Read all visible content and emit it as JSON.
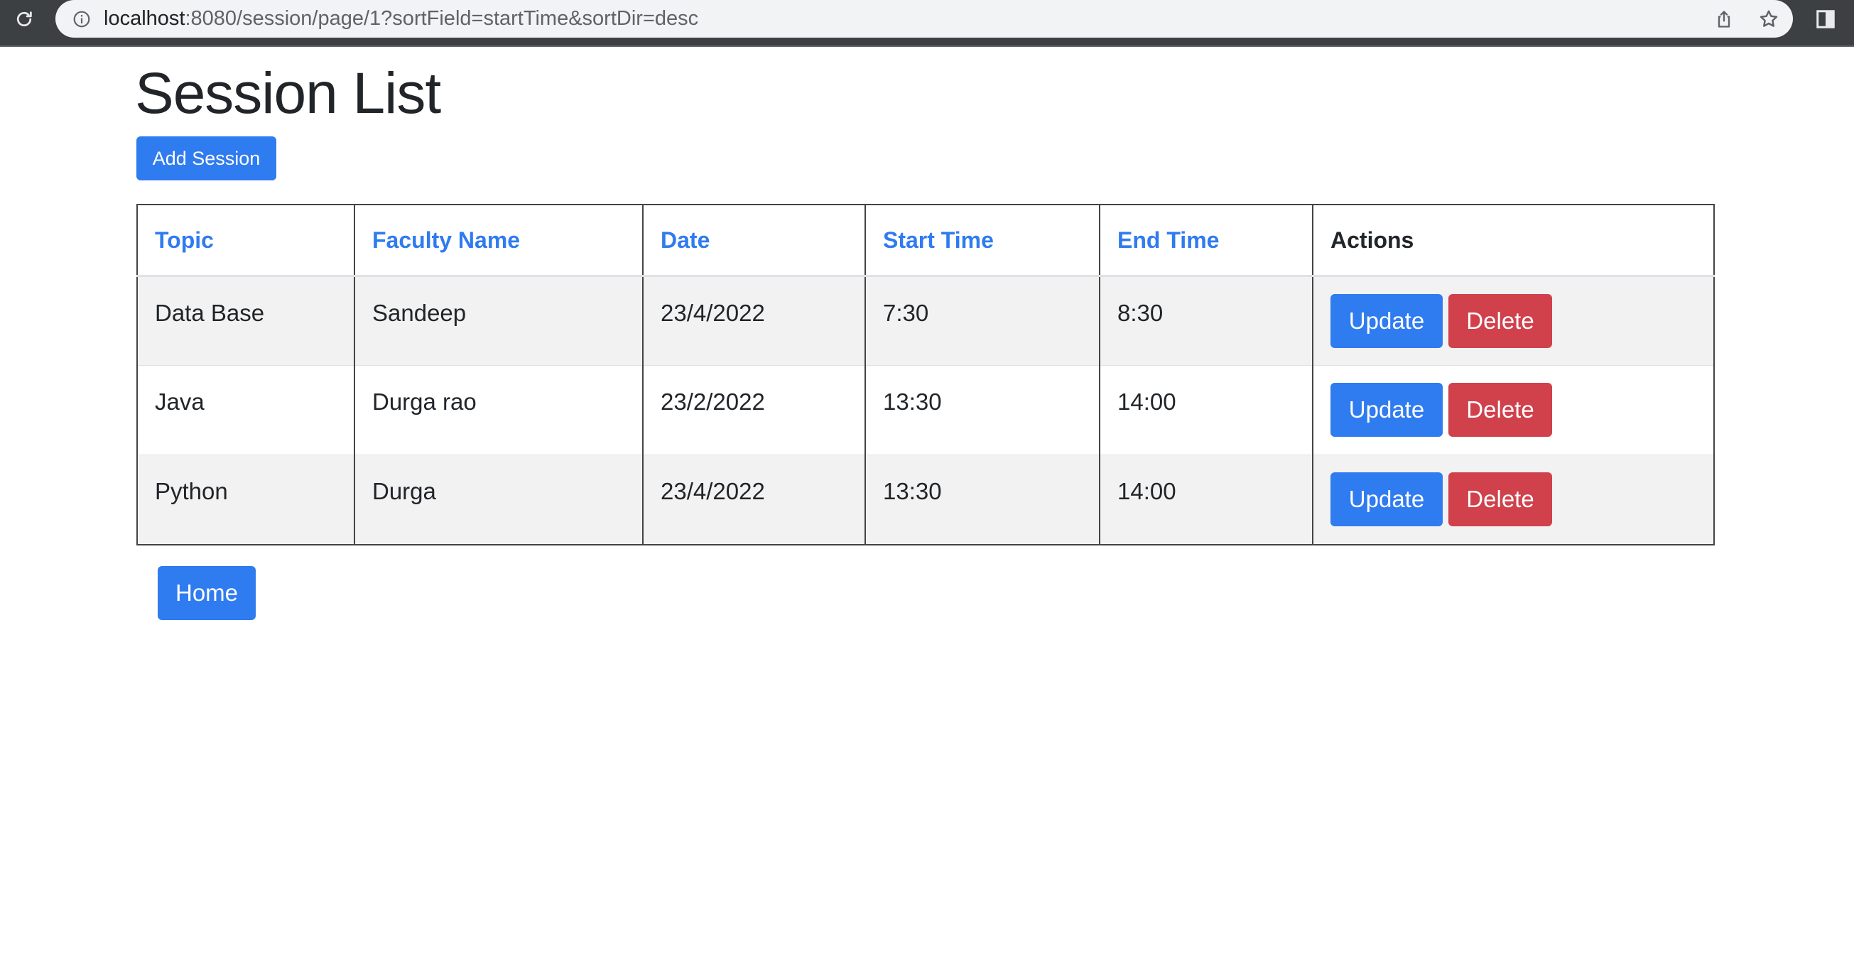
{
  "browser": {
    "url_host": "localhost",
    "url_rest": ":8080/session/page/1?sortField=startTime&sortDir=desc"
  },
  "page": {
    "title": "Session List",
    "add_button": "Add Session",
    "home_button": "Home"
  },
  "table": {
    "headers": [
      "Topic",
      "Faculty Name",
      "Date",
      "Start Time",
      "End Time",
      "Actions"
    ],
    "rows": [
      {
        "topic": "Data Base",
        "faculty": "Sandeep",
        "date": "23/4/2022",
        "start": "7:30",
        "end": "8:30"
      },
      {
        "topic": "Java",
        "faculty": "Durga rao",
        "date": "23/2/2022",
        "start": "13:30",
        "end": "14:00"
      },
      {
        "topic": "Python",
        "faculty": "Durga",
        "date": "23/4/2022",
        "start": "13:30",
        "end": "14:00"
      }
    ],
    "update_label": "Update",
    "delete_label": "Delete"
  },
  "colors": {
    "primary": "#2f7bf0",
    "danger": "#d0414c",
    "stripe": "#f2f2f2"
  }
}
